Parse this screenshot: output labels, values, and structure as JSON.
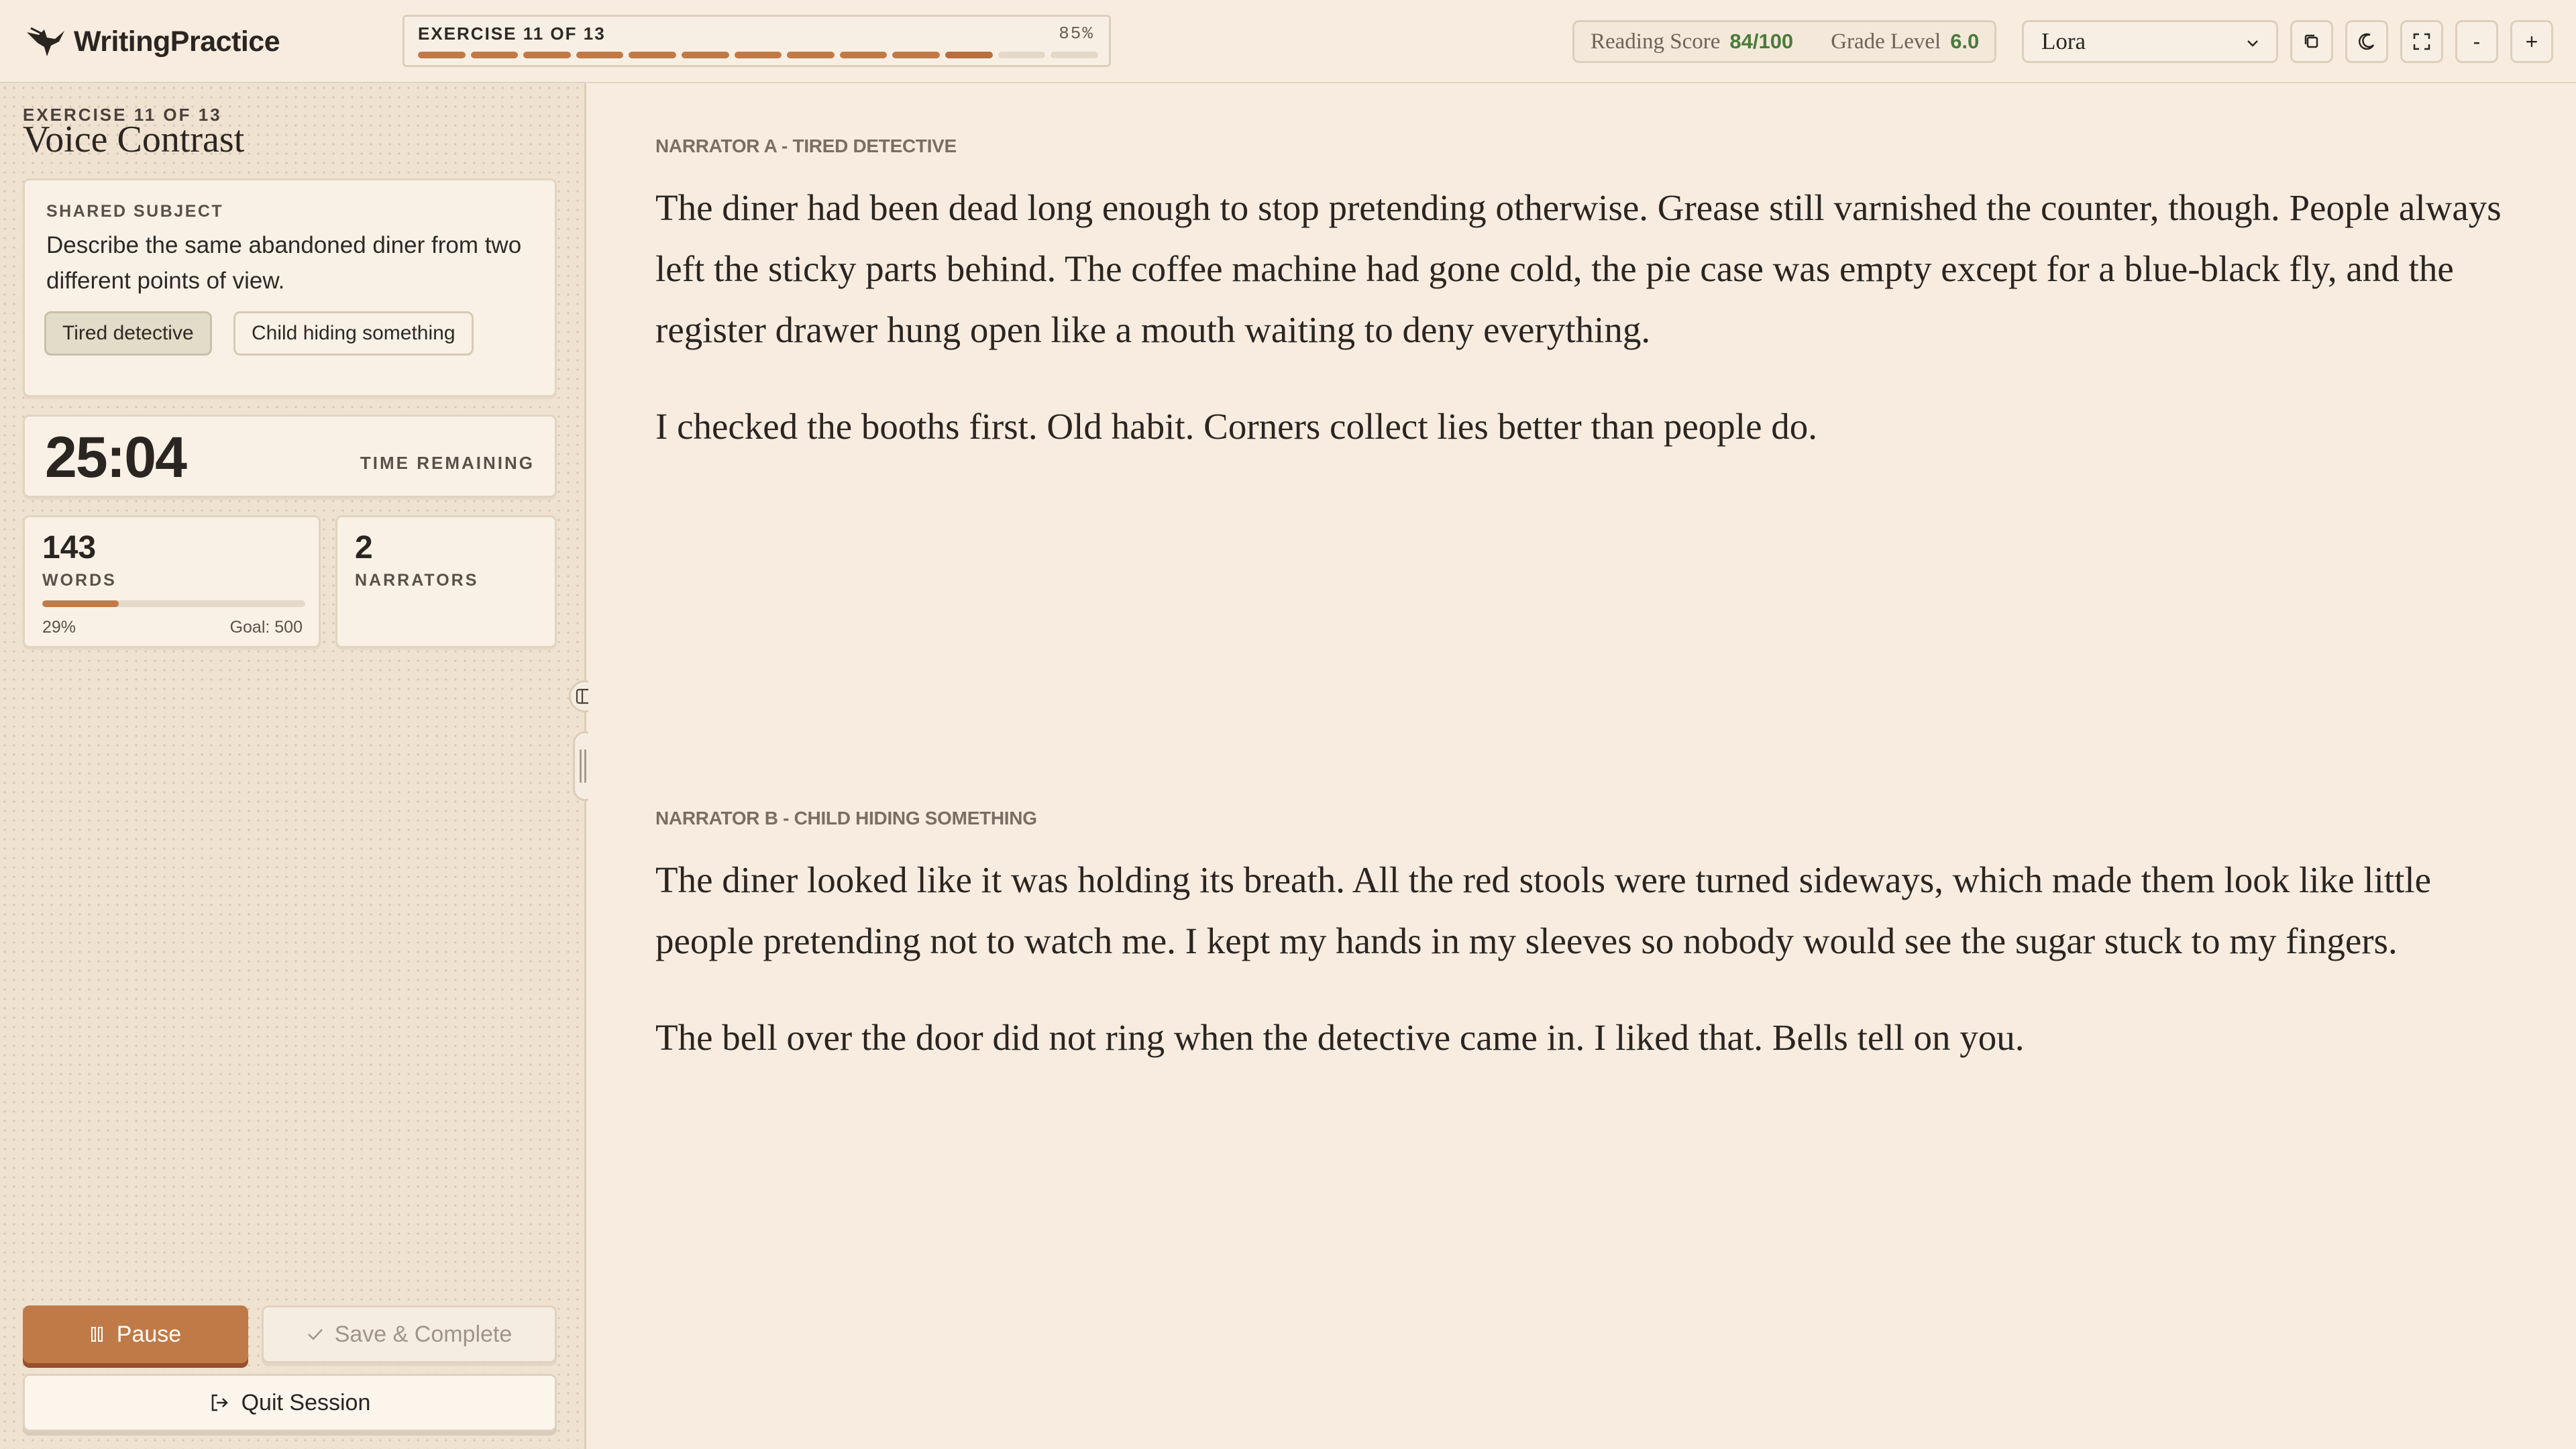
{
  "header": {
    "brand": "WritingPractice",
    "progress_label": "EXERCISE 11 OF 13",
    "progress_percent": "85%",
    "segments_total": 13,
    "segments_done": 11,
    "reading_score_label": "Reading Score",
    "reading_score_value": "84/100",
    "grade_level_label": "Grade Level",
    "grade_level_value": "6.0",
    "font_select_value": "Lora",
    "zoom_out_label": "-",
    "zoom_in_label": "+"
  },
  "sidebar": {
    "eyebrow": "EXERCISE 11 OF 13",
    "title": "Voice Contrast",
    "subject_label": "SHARED SUBJECT",
    "subject_text": "Describe the same abandoned diner from two different points of view.",
    "chips": [
      "Tired detective",
      "Child hiding something"
    ],
    "timer": "25:04",
    "timer_label": "TIME REMAINING",
    "words_count": "143",
    "words_label": "WORDS",
    "words_progress": 0.29,
    "words_pct": "29%",
    "words_goal": "Goal: 500",
    "narrators_count": "2",
    "narrators_label": "NARRATORS",
    "pause_label": "Pause",
    "save_label": "Save & Complete",
    "quit_label": "Quit Session"
  },
  "editor": {
    "narrator_a_label": "NARRATOR A - TIRED DETECTIVE",
    "narrator_a_p1": "The diner had been dead long enough to stop pretending otherwise. Grease still varnished the counter, though. People always left the sticky parts behind. The coffee machine had gone cold, the pie case was empty except for a blue-black fly, and the register drawer hung open like a mouth waiting to deny everything.",
    "narrator_a_p2": "I checked the booths first. Old habit. Corners collect lies better than people do.",
    "narrator_b_label": "NARRATOR B - CHILD HIDING SOMETHING",
    "narrator_b_p1": "The diner looked like it was holding its breath. All the red stools were turned sideways, which made them look like little people pretending not to watch me. I kept my hands in my sleeves so nobody would see the sugar stuck to my fingers.",
    "narrator_b_p2": "The bell over the door did not ring when the detective came in. I liked that. Bells tell on you."
  },
  "colors": {
    "accent": "#c07a48",
    "score_green": "#4b7a3a",
    "background": "#f6ebdd"
  }
}
